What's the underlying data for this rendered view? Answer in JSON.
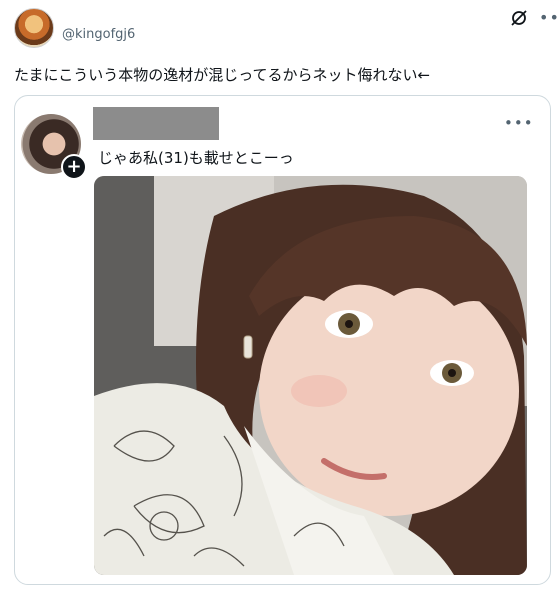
{
  "tweet": {
    "handle": "@kingofgj6",
    "text": "たまにこういう本物の逸材が混じってるからネット侮れない←",
    "grok_icon": "grok-icon",
    "more_icon": "more-horizontal-icon"
  },
  "quote": {
    "text": "じゃあ私(31)も載せとこーっ",
    "follow_icon": "plus-icon",
    "more_icon": "more-horizontal-icon",
    "photo_alt": "selfie photo"
  },
  "icons": {
    "more": "•••",
    "plus": "+"
  }
}
